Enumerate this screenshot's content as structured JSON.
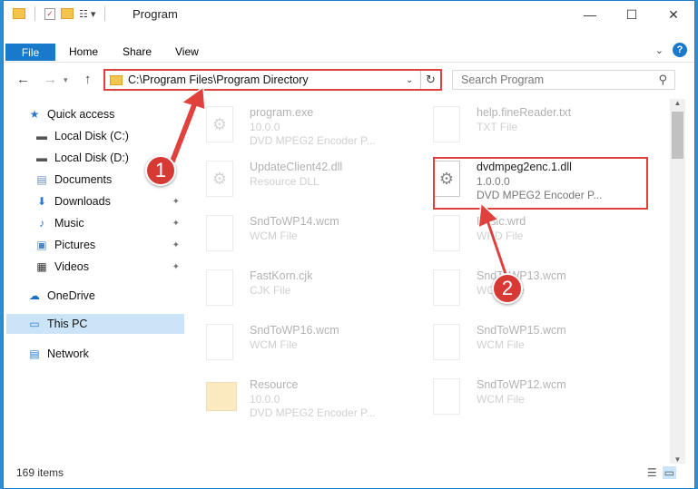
{
  "window": {
    "title": "Program",
    "controls": {
      "minimize": "—",
      "maximize": "☐",
      "close": "✕"
    }
  },
  "ribbon": {
    "tabs": [
      "File",
      "Home",
      "Share",
      "View"
    ]
  },
  "navigation": {
    "address": "C:\\Program Files\\Program Directory",
    "search_placeholder": "Search Program"
  },
  "sidebar": {
    "items": [
      {
        "label": "Quick access",
        "icon": "star-icon",
        "pinned": false
      },
      {
        "label": "Local Disk (C:)",
        "icon": "drive-icon",
        "pinned": false
      },
      {
        "label": "Local Disk (D:)",
        "icon": "drive-icon",
        "pinned": false
      },
      {
        "label": "Documents",
        "icon": "documents-icon",
        "pinned": false
      },
      {
        "label": "Downloads",
        "icon": "download-icon",
        "pinned": true
      },
      {
        "label": "Music",
        "icon": "music-icon",
        "pinned": true
      },
      {
        "label": "Pictures",
        "icon": "pictures-icon",
        "pinned": true
      },
      {
        "label": "Videos",
        "icon": "videos-icon",
        "pinned": true
      },
      {
        "label": "OneDrive",
        "icon": "cloud-icon",
        "pinned": false
      },
      {
        "label": "This PC",
        "icon": "computer-icon",
        "pinned": false,
        "selected": true
      },
      {
        "label": "Network",
        "icon": "network-icon",
        "pinned": false
      }
    ]
  },
  "files": [
    {
      "name": "program.exe",
      "line2": "10.0.0",
      "line3": "DVD MPEG2 Encoder P...",
      "icon": "exe-icon"
    },
    {
      "name": "help.fineReader.txt",
      "line2": "TXT File",
      "line3": "",
      "icon": "file-icon"
    },
    {
      "name": "UpdateClient42.dll",
      "line2": "Resource DLL",
      "line3": "",
      "icon": "dll-icon"
    },
    {
      "name": "dvdmpeg2enc.1.dll",
      "line2": "1.0.0.0",
      "line3": "DVD MPEG2 Encoder P...",
      "icon": "dll-icon",
      "highlighted": true
    },
    {
      "name": "SndToWP14.wcm",
      "line2": "WCM File",
      "line3": "",
      "icon": "file-icon"
    },
    {
      "name": "Basic.wrd",
      "line2": "WRD File",
      "line3": "",
      "icon": "file-icon"
    },
    {
      "name": "FastKorn.cjk",
      "line2": "CJK File",
      "line3": "",
      "icon": "file-icon"
    },
    {
      "name": "SndToWP13.wcm",
      "line2": "WCM File",
      "line3": "",
      "icon": "file-icon"
    },
    {
      "name": "SndToWP16.wcm",
      "line2": "WCM File",
      "line3": "",
      "icon": "file-icon"
    },
    {
      "name": "SndToWP15.wcm",
      "line2": "WCM File",
      "line3": "",
      "icon": "file-icon"
    },
    {
      "name": "Resource",
      "line2": "10.0.0",
      "line3": "DVD MPEG2 Encoder P...",
      "icon": "folder-icon"
    },
    {
      "name": "SndToWP12.wcm",
      "line2": "WCM File",
      "line3": "",
      "icon": "file-icon"
    }
  ],
  "status": {
    "item_count": "169 items"
  },
  "annotations": {
    "marker1": "1",
    "marker2": "2",
    "color": "#e0413d"
  }
}
